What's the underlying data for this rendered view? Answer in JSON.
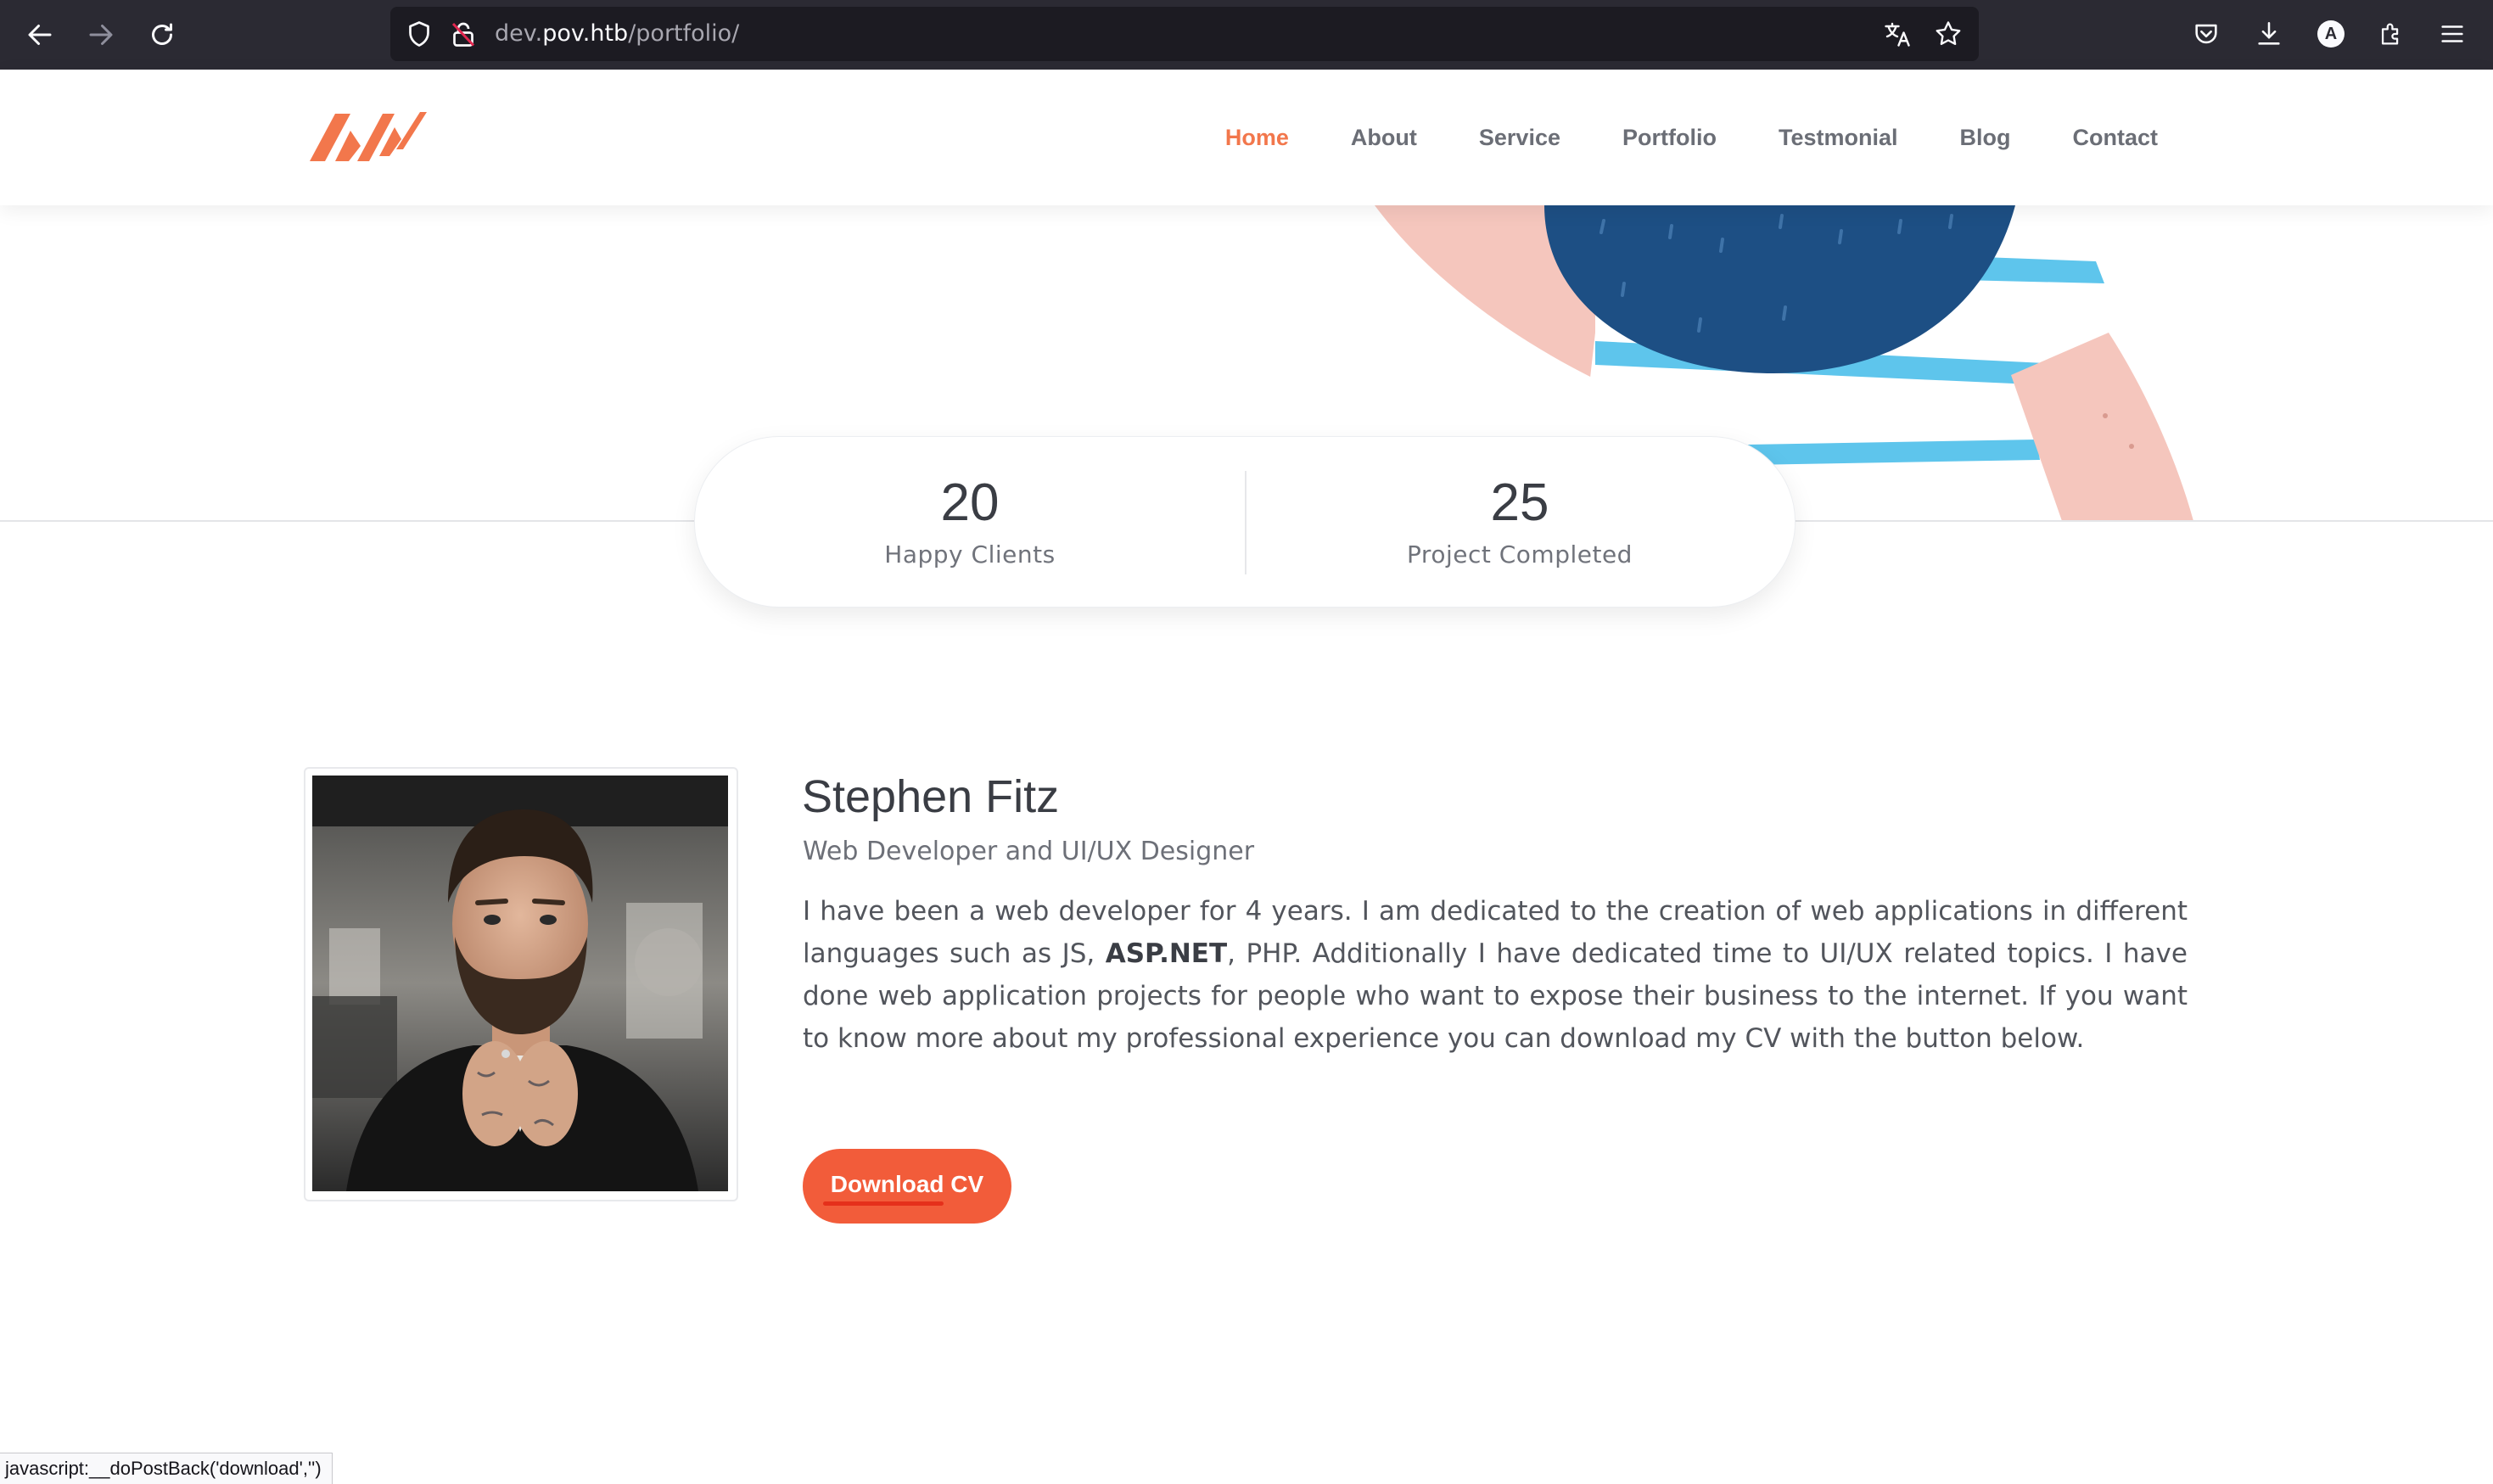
{
  "browser": {
    "url_host_prefix": "dev.",
    "url_host_main": "pov.htb",
    "url_path": "/portfolio/",
    "back_icon": "arrow-left-icon",
    "forward_icon": "arrow-right-icon",
    "reload_icon": "reload-icon",
    "profile_initial": "A"
  },
  "site": {
    "nav": [
      {
        "label": "Home",
        "active": true
      },
      {
        "label": "About"
      },
      {
        "label": "Service"
      },
      {
        "label": "Portfolio"
      },
      {
        "label": "Testmonial"
      },
      {
        "label": "Blog"
      },
      {
        "label": "Contact"
      }
    ],
    "accent_color": "#f2774c"
  },
  "stats": [
    {
      "number": "20",
      "label": "Happy Clients"
    },
    {
      "number": "25",
      "label": "Project Completed"
    }
  ],
  "about": {
    "name": "Stephen Fitz",
    "role": "Web Developer and UI/UX Designer",
    "bio_part1": "I have been a web developer for 4 years. I am dedicated to the creation of web applications in different languages such as JS, ",
    "bio_bold": "ASP.NET",
    "bio_part2": ", PHP. Additionally I have dedicated time to UI/UX related topics. I have done web application projects for people who want to expose their business to the internet. If you want to know more about my professional experience you can download my CV with the button below.",
    "cv_button": "Download CV",
    "button_color": "#f25c3a"
  },
  "status_bar": "javascript:__doPostBack('download','')"
}
